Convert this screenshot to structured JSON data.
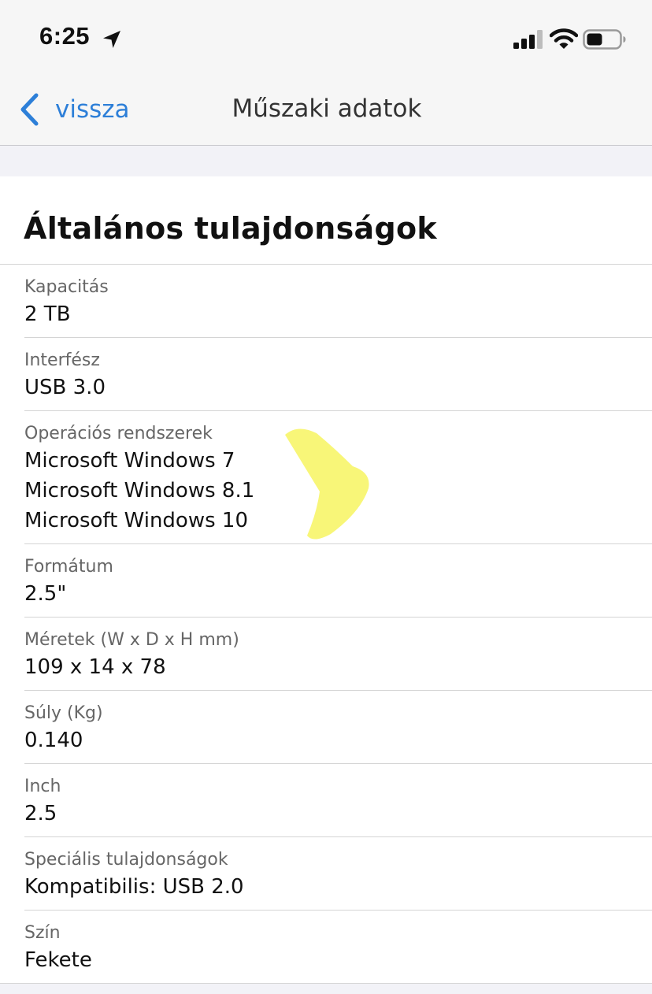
{
  "status_bar": {
    "time": "6:25",
    "icons": [
      "location-arrow-icon",
      "cellular-signal-icon",
      "wifi-icon",
      "battery-icon"
    ]
  },
  "nav": {
    "back_label": "vissza",
    "back_icon": "chevron-left-icon",
    "title": "Műszaki adatok"
  },
  "section": {
    "title": "Általános tulajdonságok"
  },
  "specs": [
    {
      "label": "Kapacitás",
      "values": [
        "2 TB"
      ]
    },
    {
      "label": "Interfész",
      "values": [
        "USB 3.0"
      ]
    },
    {
      "label": "Operációs rendszerek",
      "values": [
        "Microsoft Windows 7",
        "Microsoft Windows 8.1",
        "Microsoft Windows 10"
      ]
    },
    {
      "label": "Formátum",
      "values": [
        "2.5\""
      ]
    },
    {
      "label": "Méretek (W x D x H mm)",
      "values": [
        "109 x 14 x 78"
      ]
    },
    {
      "label": "Súly (Kg)",
      "values": [
        "0.140"
      ]
    },
    {
      "label": "Inch",
      "values": [
        "2.5"
      ]
    },
    {
      "label": "Speciális tulajdonságok",
      "values": [
        "Kompatibilis: USB 2.0"
      ]
    },
    {
      "label": "Szín",
      "values": [
        "Fekete"
      ]
    }
  ],
  "colors": {
    "accent": "#2d7fd8",
    "highlight": "#f7f560"
  }
}
